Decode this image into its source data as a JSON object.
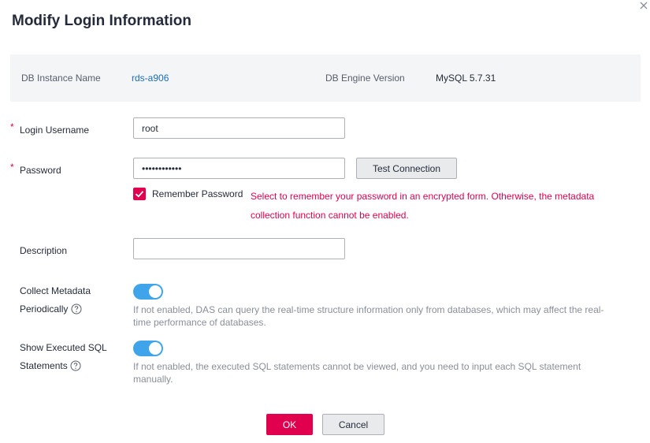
{
  "dialog": {
    "title": "Modify Login Information"
  },
  "info": {
    "instance_label": "DB Instance Name",
    "instance_value": "rds-a906",
    "engine_label": "DB Engine Version",
    "engine_value": "MySQL 5.7.31"
  },
  "form": {
    "required_mark": "*",
    "username": {
      "label": "Login Username",
      "value": "root"
    },
    "password": {
      "label": "Password",
      "value": "••••••••••••",
      "test_button": "Test Connection"
    },
    "remember": {
      "label": "Remember Password",
      "checked": true,
      "hint": "Select to remember your password in an encrypted form. Otherwise, the metadata collection function cannot be enabled."
    },
    "description": {
      "label": "Description",
      "value": ""
    },
    "collect_metadata": {
      "label_line1": "Collect Metadata",
      "label_line2": "Periodically",
      "enabled": true,
      "hint": "If not enabled, DAS can query the real-time structure information only from databases, which may affect the real-time performance of databases."
    },
    "show_sql": {
      "label_line1": "Show Executed SQL",
      "label_line2": "Statements",
      "enabled": true,
      "hint": "If not enabled, the executed SQL statements cannot be viewed, and you need to input each SQL statement manually."
    }
  },
  "footer": {
    "ok_label": "OK",
    "cancel_label": "Cancel"
  },
  "colors": {
    "accent": "#e0004d",
    "toggle_on": "#3fa4e9",
    "link": "#1c6cb4",
    "panel_bg": "#f4f5f6"
  }
}
